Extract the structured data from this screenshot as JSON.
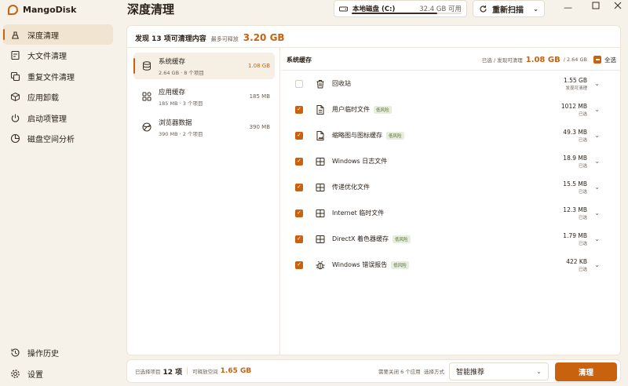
{
  "app": {
    "name": "MangoDisk",
    "page_title": "深度清理",
    "accent": "#c9620f"
  },
  "sidebar": {
    "items": [
      {
        "label": "深度清理",
        "icon": "broom-icon",
        "active": true
      },
      {
        "label": "大文件清理",
        "icon": "large-file-icon"
      },
      {
        "label": "重复文件清理",
        "icon": "duplicate-icon"
      },
      {
        "label": "应用卸载",
        "icon": "package-icon"
      },
      {
        "label": "启动项管理",
        "icon": "power-icon"
      },
      {
        "label": "磁盘空间分析",
        "icon": "pie-chart-icon"
      }
    ],
    "bottom": [
      {
        "label": "操作历史",
        "icon": "history-icon"
      },
      {
        "label": "设置",
        "icon": "gear-icon"
      }
    ]
  },
  "topbar": {
    "disk_label": "本地磁盘 (C:)",
    "disk_free": "32.4 GB 可用",
    "disk_used_fraction": 0.78,
    "rescan_label": "重新扫描"
  },
  "summary": {
    "found": "发现 13 项可清理内容",
    "release_label": "最多可释放",
    "release_value": "3.20 GB"
  },
  "categories": [
    {
      "title": "系统缓存",
      "sub": "2.64 GB · 8 个项目",
      "size": "1.08 GB",
      "active": true
    },
    {
      "title": "应用缓存",
      "sub": "185 MB · 3 个项目",
      "size": "185 MB"
    },
    {
      "title": "浏览器数据",
      "sub": "390 MB · 2 个项目",
      "size": "390 MB"
    }
  ],
  "list": {
    "header": "系统缓存",
    "selected_prefix": "已选 / 发现可清理",
    "selected_value": "1.08 GB",
    "total": "/ 2.64 GB",
    "select_all": "全选",
    "rows": [
      {
        "name": "回收站",
        "checked": false,
        "icon": "trash-icon",
        "tag": "",
        "size": "1.55 GB",
        "status": "发现可清理"
      },
      {
        "name": "用户临时文件",
        "checked": true,
        "icon": "doc-icon",
        "tag": "低风险",
        "size": "1012 MB",
        "status": "已选"
      },
      {
        "name": "缩略图与图标缓存",
        "checked": true,
        "icon": "image-icon",
        "tag": "低风险",
        "size": "49.3 MB",
        "status": "已选"
      },
      {
        "name": "Windows 日志文件",
        "checked": true,
        "icon": "window-icon",
        "tag": "",
        "size": "18.9 MB",
        "status": "已选"
      },
      {
        "name": "传递优化文件",
        "checked": true,
        "icon": "window-icon",
        "tag": "",
        "size": "15.5 MB",
        "status": "已选"
      },
      {
        "name": "Internet 临时文件",
        "checked": true,
        "icon": "window-icon",
        "tag": "",
        "size": "12.3 MB",
        "status": "已选"
      },
      {
        "name": "DirectX 着色器缓存",
        "checked": true,
        "icon": "window-icon",
        "tag": "低风险",
        "size": "1.79 MB",
        "status": "已选"
      },
      {
        "name": "Windows 错误报告",
        "checked": true,
        "icon": "bug-icon",
        "tag": "低风险",
        "size": "422 KB",
        "status": "已选"
      }
    ]
  },
  "footer": {
    "selected_label": "已选择项目",
    "selected_count": "12 项",
    "free_label": "可释放空间",
    "free_value": "1.65 GB",
    "tip": "需要关闭 6 个应用",
    "mode_label": "选择方式",
    "mode_value": "智能推荐",
    "clean_label": "清理"
  }
}
